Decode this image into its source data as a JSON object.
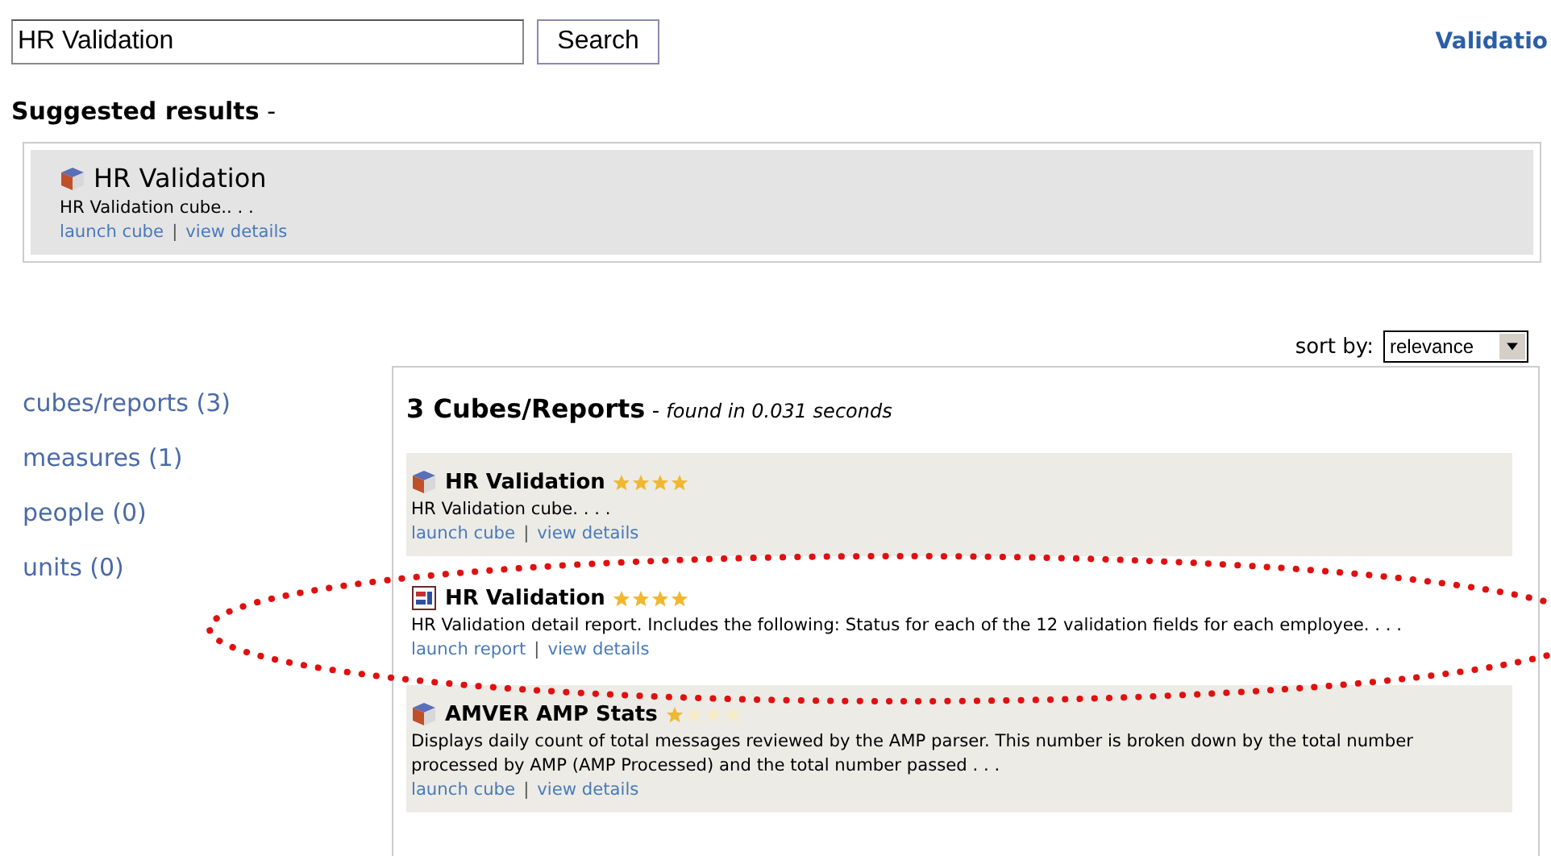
{
  "search": {
    "value": "HR Validation",
    "button": "Search"
  },
  "header_link": "Validatio",
  "suggested": {
    "heading": "Suggested results",
    "separator": "-",
    "items": [
      {
        "kind": "cube",
        "title": "HR Validation",
        "description": "HR Validation cube.. . .",
        "links": [
          "launch cube",
          "view details"
        ],
        "separator": "|"
      }
    ]
  },
  "sort": {
    "label": "sort by:",
    "value": "relevance"
  },
  "sidebar": {
    "items": [
      {
        "label": "cubes/reports (3)"
      },
      {
        "label": "measures (1)"
      },
      {
        "label": "people (0)"
      },
      {
        "label": "units (0)"
      }
    ]
  },
  "results": {
    "title": "3 Cubes/Reports",
    "separator": "-",
    "subtitle": "found in 0.031 seconds",
    "items": [
      {
        "kind": "cube",
        "title": "HR Validation",
        "stars": 4,
        "description": "HR Validation cube. . . .",
        "links": [
          "launch cube",
          "view details"
        ],
        "separator": "|"
      },
      {
        "kind": "report",
        "title": "HR Validation",
        "stars": 4,
        "description": "HR Validation detail report. Includes the following: Status for each of the 12 validation fields for each employee. . . .",
        "links": [
          "launch report",
          "view details"
        ],
        "separator": "|"
      },
      {
        "kind": "cube",
        "title": "AMVER AMP Stats",
        "stars": 1,
        "description": "Displays daily count of total messages reviewed by the AMP parser. This number is broken down by the total number processed by AMP (AMP Processed) and the total number passed . . .",
        "links": [
          "launch cube",
          "view details"
        ],
        "separator": "|"
      }
    ]
  }
}
